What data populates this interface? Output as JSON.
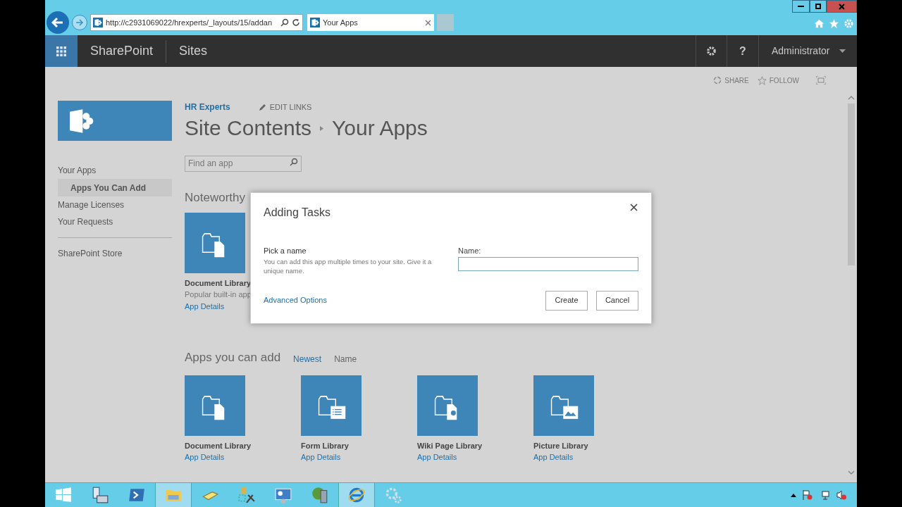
{
  "browser": {
    "address": "http://c2931069022/hrexperts/_layouts/15/addan",
    "tab": {
      "title": "Your Apps",
      "selected": true
    }
  },
  "suite_bar": {
    "brand": "SharePoint",
    "section": "Sites",
    "help": "?",
    "user": "Administrator"
  },
  "page_actions": [
    "SHARE",
    "FOLLOW"
  ],
  "header": {
    "site_link": "HR Experts",
    "edit_links": "EDIT LINKS",
    "breadcrumb": [
      "Site Contents",
      "Your Apps"
    ]
  },
  "search": {
    "placeholder": "Find an app"
  },
  "nav": {
    "items": [
      {
        "label": "Your Apps",
        "selected": false,
        "children": [
          {
            "label": "Apps You Can Add",
            "selected": true
          }
        ]
      },
      {
        "label": "Manage Licenses",
        "selected": false
      },
      {
        "label": "Your Requests",
        "selected": false
      }
    ],
    "store": "SharePoint Store"
  },
  "noteworthy": {
    "heading": "Noteworthy",
    "apps": [
      {
        "kind": "document",
        "name": "Document Library",
        "description": "Popular built-in app",
        "link": "App Details"
      }
    ]
  },
  "apps_you_can_add": {
    "heading": "Apps you can add",
    "sort": [
      {
        "label": "Newest",
        "selected": true
      },
      {
        "label": "Name",
        "selected": false
      }
    ],
    "apps": [
      {
        "kind": "document",
        "name": "Document Library",
        "link": "App Details"
      },
      {
        "kind": "form",
        "name": "Form Library",
        "link": "App Details"
      },
      {
        "kind": "wiki",
        "name": "Wiki Page Library",
        "link": "App Details"
      },
      {
        "kind": "picture",
        "name": "Picture Library",
        "link": "App Details"
      }
    ]
  },
  "dialog": {
    "title": "Adding Tasks",
    "section_title": "Pick a name",
    "description": "You can add this app multiple times to your site. Give it a unique name.",
    "field_label": "Name:",
    "link": "Advanced Options",
    "buttons": [
      "Create",
      "Cancel"
    ]
  },
  "taskbar": [
    {
      "kind": "start",
      "selected": false
    },
    {
      "kind": "server",
      "selected": false
    },
    {
      "kind": "shell",
      "selected": false
    },
    {
      "kind": "folder",
      "selected": true
    },
    {
      "kind": "notes",
      "selected": false
    },
    {
      "kind": "tools",
      "selected": false
    },
    {
      "kind": "panel",
      "selected": false
    },
    {
      "kind": "rack",
      "selected": false
    },
    {
      "kind": "browser",
      "selected": true
    },
    {
      "kind": "gears",
      "selected": false
    }
  ]
}
